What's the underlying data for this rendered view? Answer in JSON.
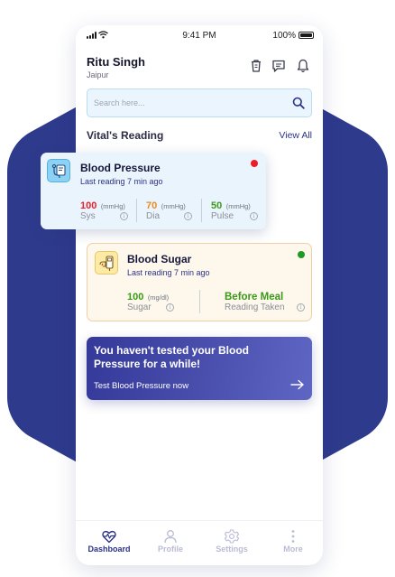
{
  "status_bar": {
    "time": "9:41 PM",
    "battery": "100%",
    "icons": [
      "signal-icon",
      "wifi-icon",
      "battery-icon"
    ]
  },
  "header": {
    "user_name": "Ritu Singh",
    "city": "Jaipur",
    "icons": [
      "trash-icon",
      "chat-icon",
      "bell-icon"
    ]
  },
  "search": {
    "placeholder": "Search here...",
    "icon": "search-icon"
  },
  "vitals_section": {
    "title": "Vital's Reading",
    "view_all": "View All"
  },
  "blood_pressure": {
    "title": "Blood Pressure",
    "last_reading": "Last reading 7 min ago",
    "icon": "blood-pressure-icon",
    "status_color": "#ee1c24",
    "metrics": [
      {
        "value": "100",
        "unit": "(mmHg)",
        "label": "Sys",
        "color": "#e8202a"
      },
      {
        "value": "70",
        "unit": "(mmHg)",
        "label": "Dia",
        "color": "#e98b1e"
      },
      {
        "value": "50",
        "unit": "(mmHg)",
        "label": "Pulse",
        "color": "#3d9b1c"
      }
    ]
  },
  "blood_sugar": {
    "title": "Blood Sugar",
    "last_reading": "Last reading 7 min ago",
    "icon": "glucometer-icon",
    "status_color": "#1f9a24",
    "metrics": [
      {
        "value": "100",
        "unit": "(mg/dl)",
        "label": "Sugar",
        "color": "#3a9a17"
      },
      {
        "value": "Before Meal",
        "label": "Reading Taken",
        "color": "#3a9a17"
      }
    ]
  },
  "reminder": {
    "title": "You haven't tested your Blood Pressure for a while!",
    "link": "Test Blood Pressure now",
    "icon": "arrow-right-icon"
  },
  "bottom_nav": {
    "active_color": "#2a3288",
    "inactive_color": "#b9bcd4",
    "items": [
      {
        "label": "Dashboard",
        "icon": "heart-pulse-icon",
        "active": true
      },
      {
        "label": "Profile",
        "icon": "person-icon",
        "active": false
      },
      {
        "label": "Settings",
        "icon": "gear-icon",
        "active": false
      },
      {
        "label": "More",
        "icon": "more-vertical-icon",
        "active": false
      }
    ]
  },
  "colors": {
    "brand": "#2a3288",
    "hexagon_background": "#2e3a8c"
  }
}
